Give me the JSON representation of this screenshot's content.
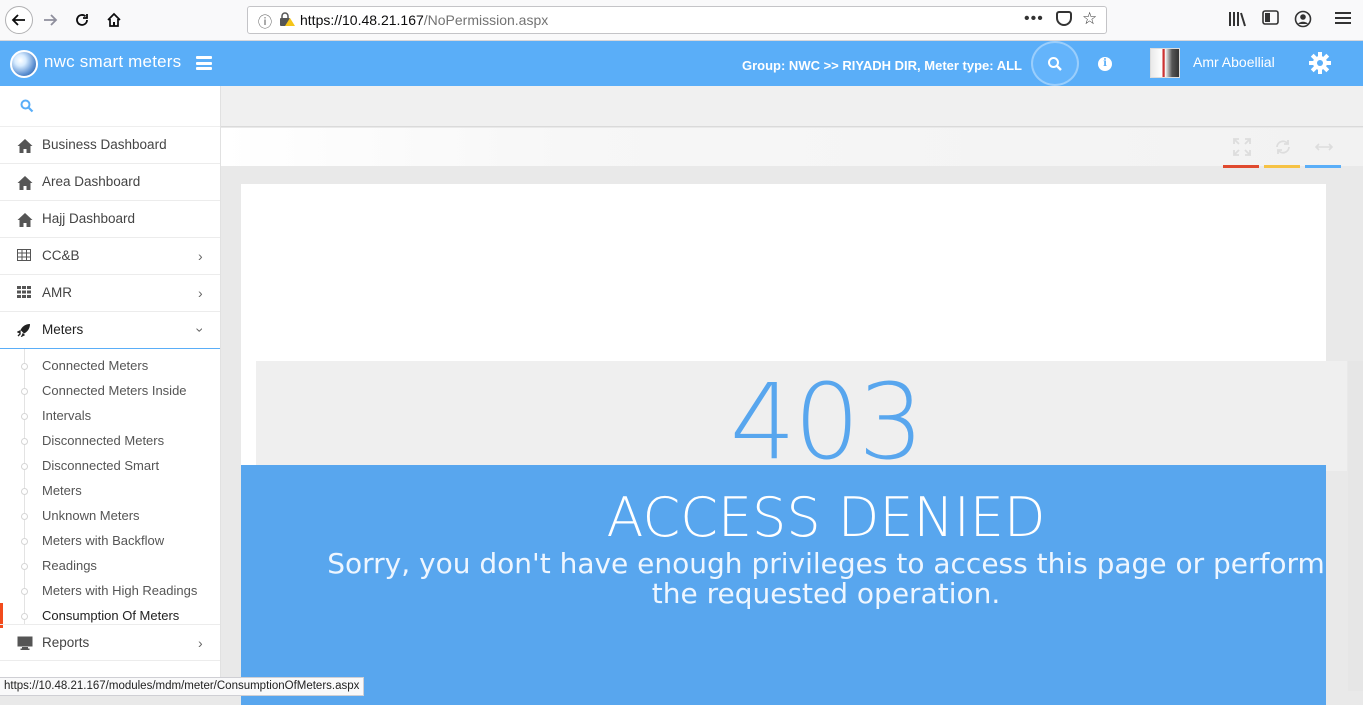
{
  "browser": {
    "url_host": "https://10.48.21.167",
    "url_path": "/NoPermission.aspx",
    "page_actions": "•••",
    "status_url": "https://10.48.21.167/modules/mdm/meter/ConsumptionOfMeters.aspx"
  },
  "header": {
    "brand": "nwc smart meters",
    "group": "Group: NWC >> RIYADH DIR, Meter type: ALL",
    "user_name": "Amr Aboellial",
    "accent_color": "#5aaef8"
  },
  "sidebar": {
    "search_icon": "search-icon",
    "items": [
      {
        "label": "Business Dashboard",
        "icon": "home-icon"
      },
      {
        "label": "Area Dashboard",
        "icon": "home-icon"
      },
      {
        "label": "Hajj Dashboard",
        "icon": "home-icon"
      },
      {
        "label": "CC&B",
        "icon": "table-icon"
      },
      {
        "label": "AMR",
        "icon": "grid-icon"
      },
      {
        "label": "Meters",
        "icon": "rocket-icon"
      }
    ],
    "meters_submenu": [
      "Connected Meters",
      "Connected Meters Inside",
      "Intervals",
      "Disconnected Meters",
      "Disconnected Smart",
      "Meters",
      "Unknown Meters",
      "Meters with Backflow",
      "Readings",
      "Meters with High Readings",
      "Consumption Of Meters"
    ],
    "reports_label": "Reports"
  },
  "toolbar": {
    "tools": [
      {
        "icon": "fullscreen-icon",
        "color": "#e04a2f"
      },
      {
        "icon": "refresh-icon",
        "color": "#f6c244"
      },
      {
        "icon": "collapse-icon",
        "color": "#5aaef8"
      }
    ]
  },
  "error": {
    "code": "403",
    "title": "ACCESS DENIED",
    "message": "Sorry, you don't have enough privileges to access this page or perform the requested operation."
  }
}
